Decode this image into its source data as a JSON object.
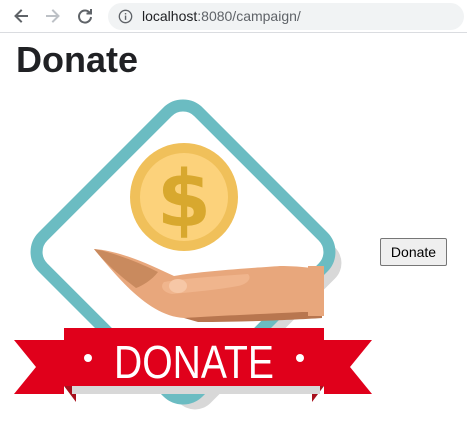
{
  "browser": {
    "url_host": "localhost",
    "url_rest": ":8080/campaign/"
  },
  "page": {
    "title": "Donate",
    "graphic_label": "DONATE",
    "button_label": "Donate"
  },
  "icons": {
    "back": "arrow-left-icon",
    "forward": "arrow-right-icon",
    "reload": "reload-icon",
    "info": "info-icon",
    "coin": "dollar-coin-icon",
    "hand": "open-hand-icon"
  },
  "colors": {
    "frame_teal": "#6bbcc2",
    "coin_outer": "#f0c05a",
    "coin_inner": "#fcd27b",
    "dollar": "#d8a82e",
    "banner_red": "#e0001b",
    "banner_dark": "#a8101d",
    "skin": "#e8a77c"
  }
}
